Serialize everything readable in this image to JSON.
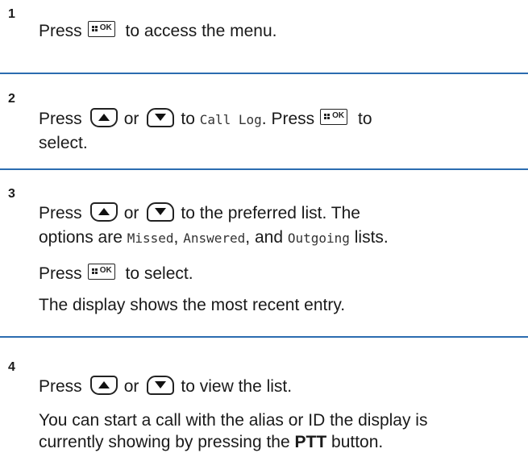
{
  "steps": [
    {
      "number": "1",
      "line1": {
        "pre": "Press",
        "post": "to access the menu."
      }
    },
    {
      "number": "2",
      "line1": {
        "pre": "Press",
        "or": "or",
        "to": "to",
        "code": "Call Log",
        "mid": ". Press",
        "post": "to"
      },
      "line2": "select."
    },
    {
      "number": "3",
      "line1": {
        "pre": "Press",
        "or": "or",
        "post": "to the preferred list. The"
      },
      "line2": {
        "pre": "options are",
        "opt1": "Missed",
        "sep1": ",",
        "opt2": "Answered",
        "sep2": ", and",
        "opt3": "Outgoing",
        "post": "lists."
      },
      "line3": {
        "pre": "Press",
        "post": "to select."
      },
      "line4": "The display shows the most recent entry."
    },
    {
      "number": "4",
      "line1": {
        "pre": "Press",
        "or": "or",
        "post": "to view the list."
      },
      "line2": "You can start a call with the alias or ID the display is",
      "line3": {
        "pre": "currently showing by pressing the",
        "bold": "PTT",
        "post": "button."
      }
    }
  ],
  "icons": {
    "ok_button_label": "OK",
    "up_button": "nav-up-icon",
    "down_button": "nav-down-icon",
    "menu_button": "menu-ok-icon"
  },
  "colors": {
    "divider": "#2b6cb0",
    "text": "#1a1a1a"
  }
}
